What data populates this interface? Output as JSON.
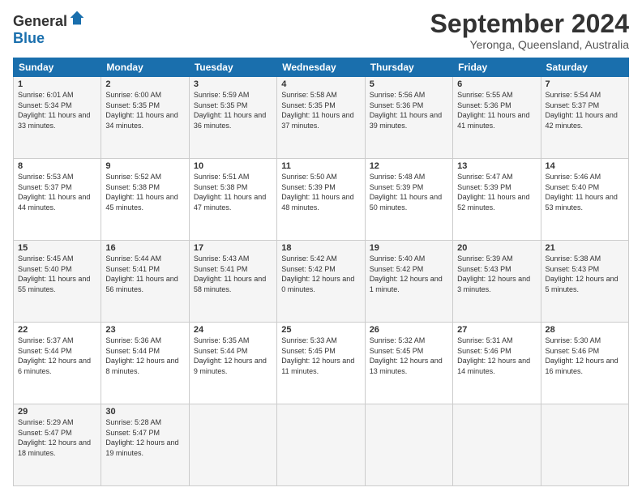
{
  "logo": {
    "general": "General",
    "blue": "Blue"
  },
  "title": "September 2024",
  "location": "Yeronga, Queensland, Australia",
  "days_of_week": [
    "Sunday",
    "Monday",
    "Tuesday",
    "Wednesday",
    "Thursday",
    "Friday",
    "Saturday"
  ],
  "weeks": [
    [
      {
        "day": "1",
        "sunrise": "6:01 AM",
        "sunset": "5:34 PM",
        "daylight": "11 hours and 33 minutes."
      },
      {
        "day": "2",
        "sunrise": "6:00 AM",
        "sunset": "5:35 PM",
        "daylight": "11 hours and 34 minutes."
      },
      {
        "day": "3",
        "sunrise": "5:59 AM",
        "sunset": "5:35 PM",
        "daylight": "11 hours and 36 minutes."
      },
      {
        "day": "4",
        "sunrise": "5:58 AM",
        "sunset": "5:35 PM",
        "daylight": "11 hours and 37 minutes."
      },
      {
        "day": "5",
        "sunrise": "5:56 AM",
        "sunset": "5:36 PM",
        "daylight": "11 hours and 39 minutes."
      },
      {
        "day": "6",
        "sunrise": "5:55 AM",
        "sunset": "5:36 PM",
        "daylight": "11 hours and 41 minutes."
      },
      {
        "day": "7",
        "sunrise": "5:54 AM",
        "sunset": "5:37 PM",
        "daylight": "11 hours and 42 minutes."
      }
    ],
    [
      {
        "day": "8",
        "sunrise": "5:53 AM",
        "sunset": "5:37 PM",
        "daylight": "11 hours and 44 minutes."
      },
      {
        "day": "9",
        "sunrise": "5:52 AM",
        "sunset": "5:38 PM",
        "daylight": "11 hours and 45 minutes."
      },
      {
        "day": "10",
        "sunrise": "5:51 AM",
        "sunset": "5:38 PM",
        "daylight": "11 hours and 47 minutes."
      },
      {
        "day": "11",
        "sunrise": "5:50 AM",
        "sunset": "5:39 PM",
        "daylight": "11 hours and 48 minutes."
      },
      {
        "day": "12",
        "sunrise": "5:48 AM",
        "sunset": "5:39 PM",
        "daylight": "11 hours and 50 minutes."
      },
      {
        "day": "13",
        "sunrise": "5:47 AM",
        "sunset": "5:39 PM",
        "daylight": "11 hours and 52 minutes."
      },
      {
        "day": "14",
        "sunrise": "5:46 AM",
        "sunset": "5:40 PM",
        "daylight": "11 hours and 53 minutes."
      }
    ],
    [
      {
        "day": "15",
        "sunrise": "5:45 AM",
        "sunset": "5:40 PM",
        "daylight": "11 hours and 55 minutes."
      },
      {
        "day": "16",
        "sunrise": "5:44 AM",
        "sunset": "5:41 PM",
        "daylight": "11 hours and 56 minutes."
      },
      {
        "day": "17",
        "sunrise": "5:43 AM",
        "sunset": "5:41 PM",
        "daylight": "11 hours and 58 minutes."
      },
      {
        "day": "18",
        "sunrise": "5:42 AM",
        "sunset": "5:42 PM",
        "daylight": "12 hours and 0 minutes."
      },
      {
        "day": "19",
        "sunrise": "5:40 AM",
        "sunset": "5:42 PM",
        "daylight": "12 hours and 1 minute."
      },
      {
        "day": "20",
        "sunrise": "5:39 AM",
        "sunset": "5:43 PM",
        "daylight": "12 hours and 3 minutes."
      },
      {
        "day": "21",
        "sunrise": "5:38 AM",
        "sunset": "5:43 PM",
        "daylight": "12 hours and 5 minutes."
      }
    ],
    [
      {
        "day": "22",
        "sunrise": "5:37 AM",
        "sunset": "5:44 PM",
        "daylight": "12 hours and 6 minutes."
      },
      {
        "day": "23",
        "sunrise": "5:36 AM",
        "sunset": "5:44 PM",
        "daylight": "12 hours and 8 minutes."
      },
      {
        "day": "24",
        "sunrise": "5:35 AM",
        "sunset": "5:44 PM",
        "daylight": "12 hours and 9 minutes."
      },
      {
        "day": "25",
        "sunrise": "5:33 AM",
        "sunset": "5:45 PM",
        "daylight": "12 hours and 11 minutes."
      },
      {
        "day": "26",
        "sunrise": "5:32 AM",
        "sunset": "5:45 PM",
        "daylight": "12 hours and 13 minutes."
      },
      {
        "day": "27",
        "sunrise": "5:31 AM",
        "sunset": "5:46 PM",
        "daylight": "12 hours and 14 minutes."
      },
      {
        "day": "28",
        "sunrise": "5:30 AM",
        "sunset": "5:46 PM",
        "daylight": "12 hours and 16 minutes."
      }
    ],
    [
      {
        "day": "29",
        "sunrise": "5:29 AM",
        "sunset": "5:47 PM",
        "daylight": "12 hours and 18 minutes."
      },
      {
        "day": "30",
        "sunrise": "5:28 AM",
        "sunset": "5:47 PM",
        "daylight": "12 hours and 19 minutes."
      },
      null,
      null,
      null,
      null,
      null
    ]
  ]
}
